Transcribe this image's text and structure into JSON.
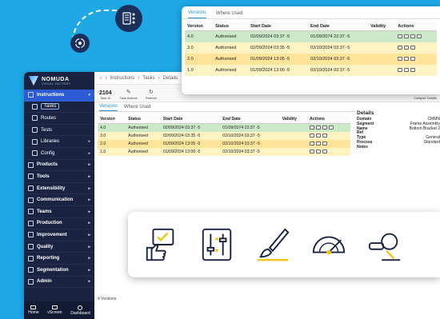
{
  "sidebar": {
    "brand": "NOMUDA",
    "brand_sub": "VISUAL FACTORY",
    "items": [
      {
        "label": "Instructions",
        "type": "main",
        "active": true
      },
      {
        "label": "Tasks",
        "type": "sub",
        "selected": true
      },
      {
        "label": "Routes",
        "type": "sub"
      },
      {
        "label": "Tests",
        "type": "sub"
      },
      {
        "label": "Libraries",
        "type": "sub"
      },
      {
        "label": "Config",
        "type": "sub"
      },
      {
        "label": "Products",
        "type": "main"
      },
      {
        "label": "Tools",
        "type": "main"
      },
      {
        "label": "Extensibility",
        "type": "main"
      },
      {
        "label": "Communication",
        "type": "main"
      },
      {
        "label": "Teams",
        "type": "main"
      },
      {
        "label": "Production",
        "type": "main"
      },
      {
        "label": "Improvement",
        "type": "main"
      },
      {
        "label": "Quality",
        "type": "main"
      },
      {
        "label": "Reporting",
        "type": "main"
      },
      {
        "label": "Segmentation",
        "type": "main"
      },
      {
        "label": "Admin",
        "type": "main"
      }
    ],
    "bottom": [
      {
        "label": "Home",
        "icon": "home-icon"
      },
      {
        "label": "vScreen",
        "icon": "monitor-icon"
      },
      {
        "label": "Dashboard",
        "icon": "info-icon"
      }
    ]
  },
  "breadcrumb": {
    "items": [
      "Instructions",
      "Tasks",
      "Details"
    ]
  },
  "toolbar": {
    "id_number": "2104",
    "id_label": "Task ID",
    "actions_label": "Task Actions",
    "refresh_label": "Refresh",
    "collapse_label": "Collapse Details"
  },
  "tabs": [
    "Versions",
    "Where Used"
  ],
  "table": {
    "headers": [
      "Version",
      "Status",
      "Start Date",
      "End Date",
      "Validity",
      "Actions"
    ],
    "rows": [
      {
        "version": "4.0",
        "status": "Authorised",
        "start": "02/09/2024 03:37 -5",
        "end": "01/09/2074 22:37 -5",
        "validity": "",
        "style": "current"
      },
      {
        "version": "3.0",
        "status": "Authorised",
        "start": "02/09/2024 03:35 -5",
        "end": "02/10/2024 03:37 -5",
        "validity": "",
        "style": "auth"
      },
      {
        "version": "2.0",
        "status": "Authorised",
        "start": "01/09/2024 13:05 -5",
        "end": "02/10/2024 03:37 -5",
        "validity": "",
        "style": "alt"
      },
      {
        "version": "1.0",
        "status": "Authorised",
        "start": "01/09/2024 13:00 -5",
        "end": "02/10/2024 03:37 -5",
        "validity": "",
        "style": "auth"
      }
    ]
  },
  "footer": {
    "count": "4 Versions"
  },
  "details": {
    "title": "Details",
    "fields": [
      {
        "k": "Domain",
        "v": "CMMN"
      },
      {
        "k": "Segment",
        "v": "Frame Assembly"
      },
      {
        "k": "Name",
        "v": "Bottom Bracket 2"
      },
      {
        "k": "Ref",
        "v": ""
      },
      {
        "k": "Type",
        "v": "General"
      },
      {
        "k": "Process",
        "v": "Standard"
      },
      {
        "k": "Notes",
        "v": ""
      }
    ]
  },
  "colors": {
    "background": "#1ea8e6",
    "sidebar": "#1b2342",
    "active": "#2d5bd6",
    "row_current": "#cbe8c7",
    "row_auth": "#fff3c4",
    "row_alt": "#ffe49a",
    "accent_yellow": "#f5c518"
  },
  "banner_icons": [
    "thumbs-up-approval-icon",
    "sliders-icon",
    "paintbrush-icon",
    "protractor-icon",
    "angle-grinder-icon"
  ]
}
